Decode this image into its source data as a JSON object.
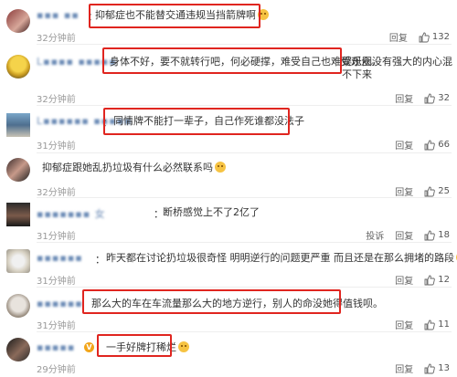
{
  "comments": [
    {
      "name": "▪▪▪ ▪▪",
      "text": "抑郁症也不能替交通违规当挡箭牌啊",
      "time": "32分钟前",
      "actions": [
        "回复"
      ],
      "likes": "132"
    },
    {
      "name": "L▪▪▪▪ ▪▪▪▪▪",
      "text": "身体不好，要不就转行吧，何必硬撑，难受自己也难受观众。",
      "text_cont": "娱乐圈没有强大的内心混不下来",
      "time": "32分钟前",
      "actions": [
        "回复"
      ],
      "likes": "32"
    },
    {
      "name": "L▪▪▪▪▪▪ ▪▪▪▪▪",
      "text": "同情牌不能打一辈子，自己作死谁都没法子",
      "time": "31分钟前",
      "actions": [
        "回复"
      ],
      "likes": "66"
    },
    {
      "name": "",
      "text": "抑郁症跟她乱扔垃圾有什么必然联系吗",
      "time": "32分钟前",
      "actions": [
        "回复"
      ],
      "likes": "25"
    },
    {
      "name": "▪▪▪▪▪▪▪ 女",
      "text": "断桥感觉上不了2亿了",
      "time": "31分钟前",
      "actions": [
        "投诉",
        "回复"
      ],
      "likes": "18"
    },
    {
      "name": "▪▪▪▪▪▪",
      "text": "昨天都在讨论扔垃圾很奇怪 明明逆行的问题更严重 而且还是在那么拥堵的路段",
      "time": "31分钟前",
      "actions": [
        "回复"
      ],
      "likes": "12"
    },
    {
      "name": "▪▪▪▪▪▪",
      "text": "那么大的车在车流量那么大的地方逆行，别人的命没她得值钱呗。",
      "time": "31分钟前",
      "actions": [
        "回复"
      ],
      "likes": "11"
    },
    {
      "name": "▪▪▪▪▪",
      "text": "一手好牌打稀烂",
      "time": "29分钟前",
      "actions": [
        "回复"
      ],
      "likes": "13"
    }
  ],
  "colors": {
    "highlight": "#e0251f",
    "time": "#999999",
    "text": "#333333"
  },
  "icons": {
    "like": "thumbs-up-icon",
    "emoji": "smile-emoji-icon",
    "verified": "v-badge-icon"
  }
}
